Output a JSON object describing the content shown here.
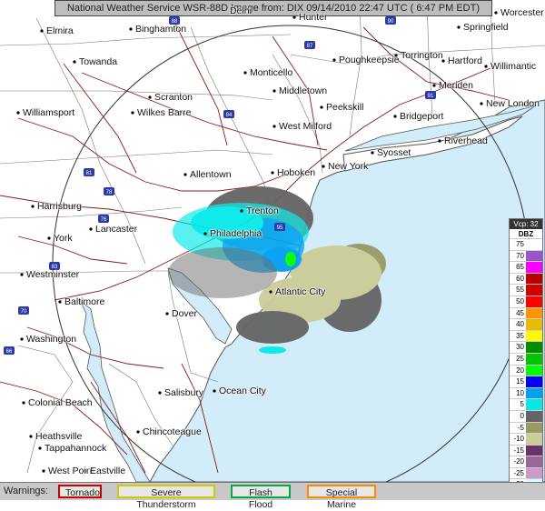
{
  "header": {
    "title": "National Weather Service WSR-88D Image  from: DIX 09/14/2010 22:47 UTC ( 6:47 PM EDT)"
  },
  "cities": [
    {
      "name": "Delhi"
    },
    {
      "name": "Hunter"
    },
    {
      "name": "Worcester"
    },
    {
      "name": "Elmira"
    },
    {
      "name": "Binghamton"
    },
    {
      "name": "Springfield"
    },
    {
      "name": "Towanda"
    },
    {
      "name": "Monticello"
    },
    {
      "name": "Poughkeepsie"
    },
    {
      "name": "Torrington"
    },
    {
      "name": "Hartford"
    },
    {
      "name": "Willimantic"
    },
    {
      "name": "Middletown"
    },
    {
      "name": "Meriden"
    },
    {
      "name": "Scranton"
    },
    {
      "name": "Wilkes Barre"
    },
    {
      "name": "Peekskill"
    },
    {
      "name": "New London"
    },
    {
      "name": "Williamsport"
    },
    {
      "name": "West Milford"
    },
    {
      "name": "Bridgeport"
    },
    {
      "name": "Riverhead"
    },
    {
      "name": "Syosset"
    },
    {
      "name": "Allentown"
    },
    {
      "name": "Hoboken"
    },
    {
      "name": "New York"
    },
    {
      "name": "Harrisburg"
    },
    {
      "name": "Trenton"
    },
    {
      "name": "Lancaster"
    },
    {
      "name": "Philadelphia"
    },
    {
      "name": "York"
    },
    {
      "name": "Westminster"
    },
    {
      "name": "Atlantic City"
    },
    {
      "name": "Baltimore"
    },
    {
      "name": "Dover"
    },
    {
      "name": "Washington"
    },
    {
      "name": "Salisbury"
    },
    {
      "name": "Ocean City"
    },
    {
      "name": "Colonial Beach"
    },
    {
      "name": "Chincoteague"
    },
    {
      "name": "Heathsville"
    },
    {
      "name": "Tappahannock"
    },
    {
      "name": "West Point"
    },
    {
      "name": "Eastville"
    }
  ],
  "highway_shields": [
    "88",
    "90",
    "87",
    "84",
    "81",
    "78",
    "76",
    "83",
    "70",
    "95",
    "66",
    "91"
  ],
  "legend": {
    "vcp_label": "Vcp: 32",
    "unit": "DBZ",
    "rows": [
      {
        "label": "75",
        "color": "#ffffff"
      },
      {
        "label": "70",
        "color": "#9955c9"
      },
      {
        "label": "65",
        "color": "#f800fd"
      },
      {
        "label": "60",
        "color": "#bc0000"
      },
      {
        "label": "55",
        "color": "#d40000"
      },
      {
        "label": "50",
        "color": "#fd0000"
      },
      {
        "label": "45",
        "color": "#fd9500"
      },
      {
        "label": "40",
        "color": "#e5bc00"
      },
      {
        "label": "35",
        "color": "#fdf802"
      },
      {
        "label": "30",
        "color": "#008e00"
      },
      {
        "label": "25",
        "color": "#01c501"
      },
      {
        "label": "20",
        "color": "#02fd02"
      },
      {
        "label": "15",
        "color": "#0300f4"
      },
      {
        "label": "10",
        "color": "#019ff4"
      },
      {
        "label": "5",
        "color": "#04e9e7"
      },
      {
        "label": "0",
        "color": "#646464"
      },
      {
        "label": "-5",
        "color": "#999966"
      },
      {
        "label": "-10",
        "color": "#cccc99"
      },
      {
        "label": "-15",
        "color": "#663366"
      },
      {
        "label": "-20",
        "color": "#996699"
      },
      {
        "label": "-25",
        "color": "#cc99cc"
      },
      {
        "label": "-30",
        "color": "#ccffff"
      },
      {
        "label": "ND",
        "color": "#ffffff"
      }
    ]
  },
  "warnings": {
    "label": "Warnings:",
    "buttons": [
      {
        "label": "Tornado",
        "color": "#cc0000"
      },
      {
        "label": "Severe Thunderstorm",
        "color": "#cccc00"
      },
      {
        "label": "Flash Flood",
        "color": "#00aa44"
      },
      {
        "label": "Special Marine",
        "color": "#ff8800"
      }
    ]
  }
}
